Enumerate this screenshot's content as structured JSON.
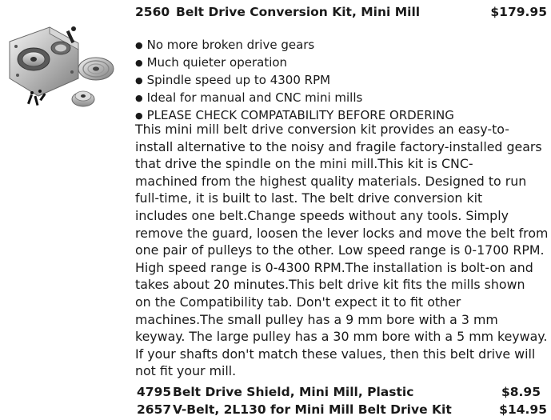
{
  "product": {
    "sku": "2560",
    "name": "Belt Drive Conversion Kit, Mini Mill",
    "price": "$179.95",
    "image_alt_icon": "belt-drive-kit-photo",
    "features": [
      "No more broken drive gears",
      "Much quieter operation",
      "Spindle speed up to 4300 RPM",
      "Ideal for manual and CNC mini mills",
      "PLEASE CHECK COMPATABILITY BEFORE ORDERING"
    ],
    "description": "This mini mill belt drive conversion kit provides an easy-to-\ninstall alternative to the noisy and fragile factory-installed gears\nthat drive the spindle on the mini mill.This kit is CNC-\nmachined from the highest quality materials. Designed to run\nfull-time, it is built to last. The belt drive conversion kit\nincludes one belt.Change speeds without any tools. Simply\nremove the guard, loosen the lever locks and move the belt from\none pair of pulleys to the other. Low speed range is 0-1700 RPM.\nHigh speed range is 0-4300 RPM.The installation is bolt-on and\ntakes about 20 minutes.This belt drive kit fits the mills shown\non the Compatibility tab. Don't expect it to fit other\nmachines.The small pulley has a 9 mm bore with a 3 mm\nkeyway. The large pulley has a 30 mm bore with a 5 mm keyway.\nIf your shafts don't match these values, then this belt drive will\nnot fit your mill."
  },
  "related": [
    {
      "sku": "4795",
      "name": "Belt Drive Shield, Mini Mill, Plastic",
      "price": "$8.95"
    },
    {
      "sku": "2657",
      "name": "V-Belt, 2L130 for Mini Mill Belt Drive Kit",
      "price": "$14.95"
    }
  ]
}
